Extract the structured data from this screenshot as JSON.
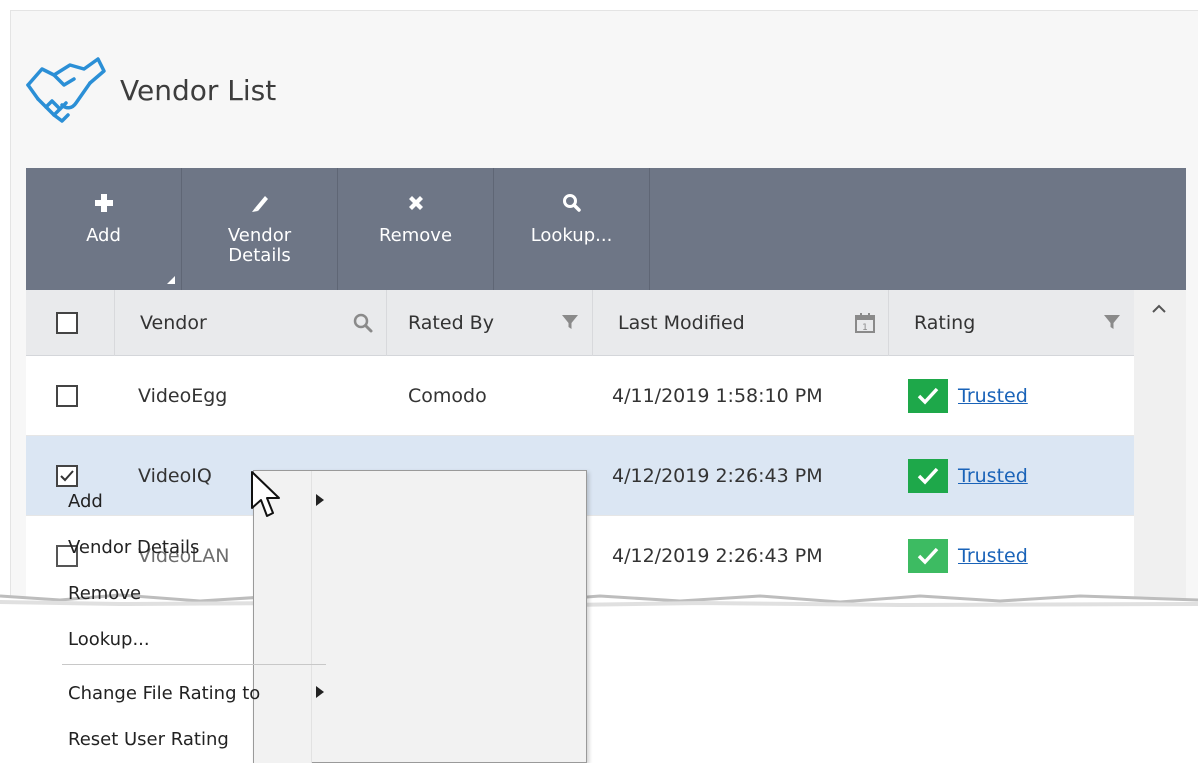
{
  "page": {
    "title": "Vendor List"
  },
  "toolbar": {
    "buttons": [
      {
        "label": "Add",
        "icon": "plus-icon",
        "has_dropdown": true
      },
      {
        "label": "Vendor\nDetails",
        "icon": "pencil-icon"
      },
      {
        "label": "Remove",
        "icon": "x-icon"
      },
      {
        "label": "Lookup...",
        "icon": "search-icon"
      }
    ]
  },
  "grid": {
    "columns": [
      {
        "label": "Vendor",
        "icon": "search-icon"
      },
      {
        "label": "Rated By",
        "icon": "filter-icon"
      },
      {
        "label": "Last Modified",
        "icon": "calendar-icon",
        "calendar_digit": "1"
      },
      {
        "label": "Rating",
        "icon": "filter-icon"
      }
    ],
    "rows": [
      {
        "checked": false,
        "vendor": "VideoEgg",
        "rated_by": "Comodo",
        "last_modified": "4/11/2019 1:58:10 PM",
        "rating": "Trusted"
      },
      {
        "checked": true,
        "vendor": "VideoIQ",
        "rated_by": "",
        "last_modified": "4/12/2019 2:26:43 PM",
        "rating": "Trusted"
      },
      {
        "checked": false,
        "vendor": "VideoLAN",
        "rated_by": "",
        "last_modified": "4/12/2019 2:26:43 PM",
        "rating": "Trusted"
      }
    ]
  },
  "context_menu": {
    "items": [
      {
        "label": "Add",
        "submenu": true
      },
      {
        "label": "Vendor Details",
        "submenu": false
      },
      {
        "label": "Remove",
        "submenu": false
      },
      {
        "label": "Lookup...",
        "submenu": false
      },
      {
        "label": "Change File Rating to",
        "submenu": true
      },
      {
        "label": "Reset User Rating",
        "submenu": false
      }
    ]
  },
  "colors": {
    "toolbar_bg": "#6e7686",
    "selected_row": "#dbe6f3",
    "trusted_green": "#1ea84a",
    "link_blue": "#1a63b8",
    "logo_blue": "#2b8fd6"
  }
}
